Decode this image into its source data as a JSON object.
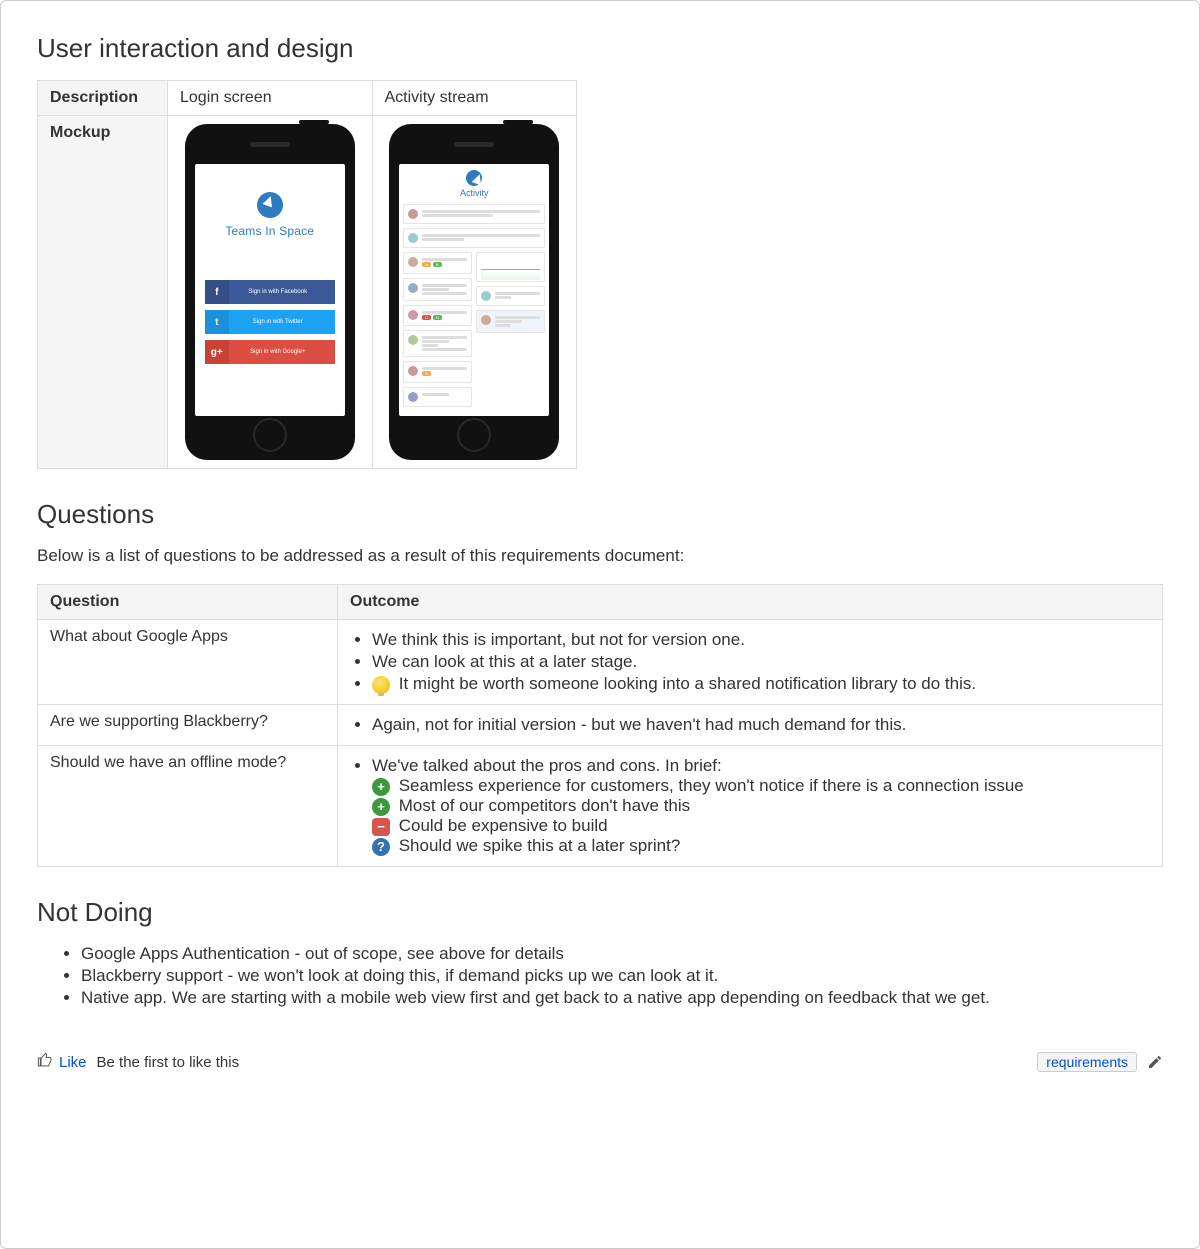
{
  "sections": {
    "design_heading": "User interaction and design",
    "questions_heading": "Questions",
    "questions_intro": "Below is a list of questions to be addressed as a result of this requirements document:",
    "notdoing_heading": "Not Doing"
  },
  "mockup_table": {
    "row_headers": {
      "description": "Description",
      "mockup": "Mockup"
    },
    "cols": [
      "Login screen",
      "Activity stream"
    ]
  },
  "login_mock": {
    "brand": "Teams In Space",
    "buttons": {
      "facebook": "Sign in with Facebook",
      "twitter": "Sign in with Twitter",
      "google": "Sign in with Google+"
    }
  },
  "activity_mock": {
    "title": "Activity"
  },
  "q_table": {
    "headers": {
      "question": "Question",
      "outcome": "Outcome"
    },
    "rows": [
      {
        "question": "What about Google Apps",
        "outcomes": [
          {
            "icon": "",
            "text": "We think this is important, but not for version one."
          },
          {
            "icon": "",
            "text": "We can look at this at a later stage."
          },
          {
            "icon": "bulb",
            "text": "It might be worth someone looking into a shared notification library to do this."
          }
        ]
      },
      {
        "question": "Are we supporting Blackberry?",
        "outcomes": [
          {
            "icon": "",
            "text": "Again, not for initial version - but we haven't had much demand for this."
          }
        ]
      },
      {
        "question": "Should we have an offline mode?",
        "outcomes_intro": "We've talked about the pros and cons. In brief:",
        "outcomes": [
          {
            "icon": "plus",
            "text": "Seamless experience for customers, they won't notice if there is a connection issue"
          },
          {
            "icon": "plus",
            "text": "Most of our competitors don't have this"
          },
          {
            "icon": "minus",
            "text": "Could be expensive to build"
          },
          {
            "icon": "q",
            "text": "Should we spike this at a later sprint?"
          }
        ]
      }
    ]
  },
  "not_doing": [
    "Google Apps Authentication - out of scope, see above for details",
    "Blackberry support - we won't look at doing this, if demand picks up we can look at it.",
    "Native app. We are starting with a mobile web view first and get back to a native app depending on feedback that we get."
  ],
  "footer": {
    "like": "Like",
    "like_hint": "Be the first to like this",
    "label": "requirements"
  }
}
